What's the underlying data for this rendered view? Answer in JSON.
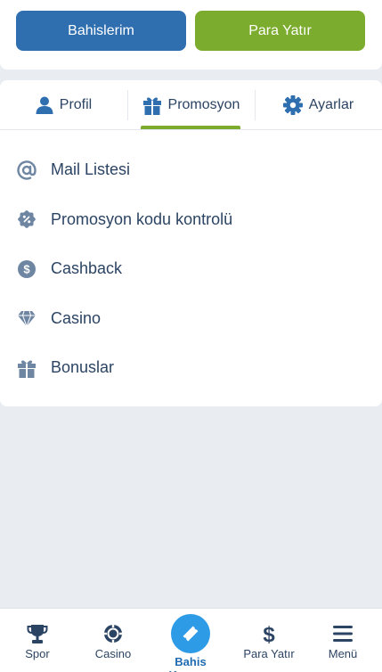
{
  "top_actions": {
    "bets_label": "Bahislerim",
    "deposit_label": "Para Yatır"
  },
  "tabs": [
    {
      "label": "Profil",
      "icon": "user-icon"
    },
    {
      "label": "Promosyon",
      "icon": "gift-icon",
      "active": true
    },
    {
      "label": "Ayarlar",
      "icon": "gear-icon"
    }
  ],
  "menu": [
    {
      "label": "Mail Listesi",
      "icon": "at-icon"
    },
    {
      "label": "Promosyon kodu kontrolü",
      "icon": "percent-badge-icon"
    },
    {
      "label": "Cashback",
      "icon": "dollar-coin-icon"
    },
    {
      "label": "Casino",
      "icon": "diamond-icon"
    },
    {
      "label": "Bonuslar",
      "icon": "gift-icon"
    }
  ],
  "bottom_nav": [
    {
      "label": "Spor",
      "icon": "trophy-icon"
    },
    {
      "label": "Casino",
      "icon": "poker-chip-icon"
    },
    {
      "label": "Bahis Kuponu",
      "icon": "ticket-icon",
      "active": true
    },
    {
      "label": "Para Yatır",
      "icon": "dollar-icon"
    },
    {
      "label": "Menü",
      "icon": "hamburger-icon"
    }
  ],
  "colors": {
    "primary_blue": "#2f6fb0",
    "accent_green": "#7cac2d",
    "text_dark": "#2c4463",
    "icon_grey": "#6f86a3",
    "background": "#e9edf2",
    "coupon_blue": "#2e9be6"
  }
}
